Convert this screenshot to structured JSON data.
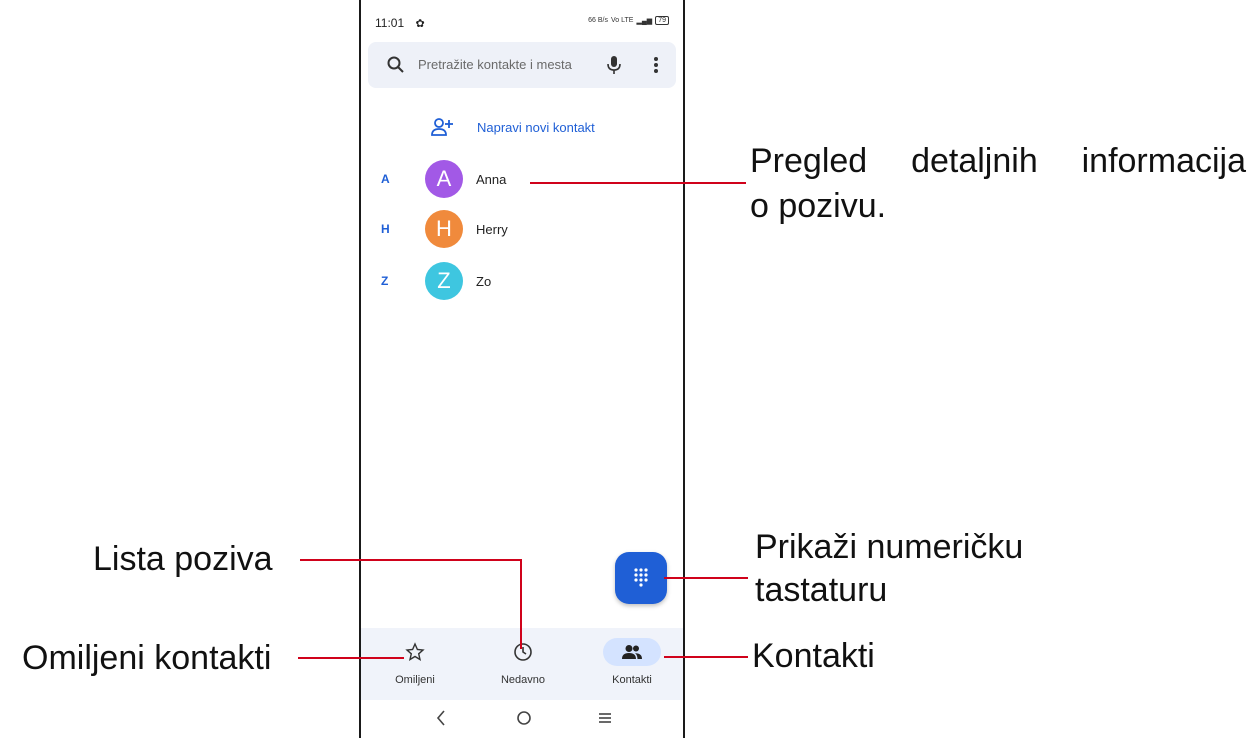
{
  "status_bar": {
    "time": "11:01",
    "net": "66 B/s",
    "lte": "Vo LTE",
    "battery": "79"
  },
  "search": {
    "placeholder": "Pretražite kontakte i mesta"
  },
  "new_contact": {
    "label": "Napravi novi kontakt"
  },
  "contacts": [
    {
      "letter": "A",
      "initial": "A",
      "name": "Anna",
      "color": "#a259e6"
    },
    {
      "letter": "H",
      "initial": "H",
      "name": "Herry",
      "color": "#f08a3c"
    },
    {
      "letter": "Z",
      "initial": "Z",
      "name": "Zo",
      "color": "#3ec6e0"
    }
  ],
  "bottom_nav": [
    {
      "label": "Omiljeni",
      "icon": "star-icon"
    },
    {
      "label": "Nedavno",
      "icon": "clock-icon"
    },
    {
      "label": "Kontakti",
      "icon": "people-icon"
    }
  ],
  "annotations": {
    "details_line1": "Pregled detaljnih informacija",
    "details_line2": "o pozivu.",
    "call_list": "Lista poziva",
    "dialpad_line1": "Prikaži numeričku",
    "dialpad_line2": "tastaturu",
    "favorites": "Omiljeni kontakti",
    "contacts": "Kontakti"
  },
  "colors": {
    "accent": "#1f5fd6",
    "annotation_line": "#d0021b"
  }
}
